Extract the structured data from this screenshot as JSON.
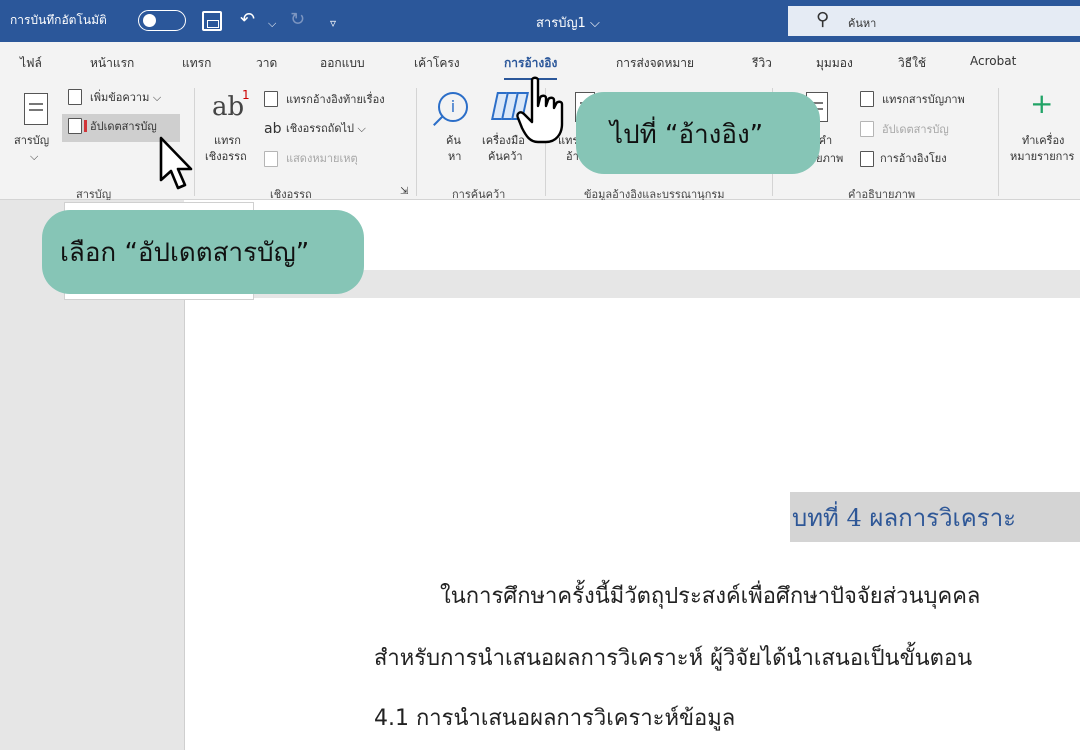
{
  "titlebar": {
    "autosave_label": "การบันทึกอัตโนมัติ",
    "doc_title": "สารบัญ1 ⌵",
    "search_placeholder": "ค้นหา"
  },
  "tabs": [
    "ไฟล์",
    "หน้าแรก",
    "แทรก",
    "วาด",
    "ออกแบบ",
    "เค้าโครง",
    "การอ้างอิง",
    "การส่งจดหมาย",
    "รีวิว",
    "มุมมอง",
    "วิธีใช้",
    "Acrobat"
  ],
  "active_tab": "การอ้างอิง",
  "ribbon": {
    "toc_group": {
      "big_label": "สารบัญ",
      "add_text": "เพิ่มข้อความ ⌵",
      "update_toc": "อัปเดตสารบัญ",
      "group_label": "สารบัญ"
    },
    "footnote_group": {
      "insert_label_1": "แทรก",
      "insert_label_2": "เชิงอรรถ",
      "insert_endnote": "แทรกอ้างอิงท้ายเรื่อง",
      "next_footnote": "เชิงอรรถถัดไป ⌵",
      "show_notes": "แสดงหมายเหตุ",
      "group_label": "เชิงอรรถ"
    },
    "research_group": {
      "search_1": "ค้น",
      "search_2": "หา",
      "researcher_1": "เครื่องมือ",
      "researcher_2": "ค้นคว้า",
      "group_label": "การค้นคว้า"
    },
    "citation_group": {
      "insert_1": "แทร",
      "insert_2": "อ้า",
      "group_label": "ข้อมูลอ้างอิงและบรรณานุกรม"
    },
    "caption_group": {
      "insert_caption_1": "กคำ",
      "insert_caption_2": "ายภาพ",
      "insert_table_of_figures": "แทรกสารบัญภาพ",
      "update_table": "อัปเดตสารบัญ",
      "cross_reference": "การอ้างอิงโยง",
      "group_label": "คำอธิบายภาพ"
    },
    "index_group": {
      "mark_1": "ทำเครื่อง",
      "mark_2": "หมายรายการ"
    }
  },
  "document": {
    "chapter_heading": "บทที่ 4 ผลการวิเคราะ",
    "para1": "ในการศึกษาครั้งนี้มีวัตถุประสงค์เพื่อศึกษาปัจจัยส่วนบุคคล",
    "para2": "สำหรับการนำเสนอผลการวิเคราะห์ ผู้วิจัยได้นำเสนอเป็นขั้นตอน",
    "para3": "4.1 การนำเสนอผลการวิเคราะห์ข้อมูล"
  },
  "callouts": {
    "goto": "ไปที่ “อ้างอิง”",
    "select": "เลือก “อัปเดตสารบัญ”"
  },
  "colors": {
    "titlebar": "#2b579a",
    "callout": "#86c5b6",
    "heading": "#2e5797"
  }
}
